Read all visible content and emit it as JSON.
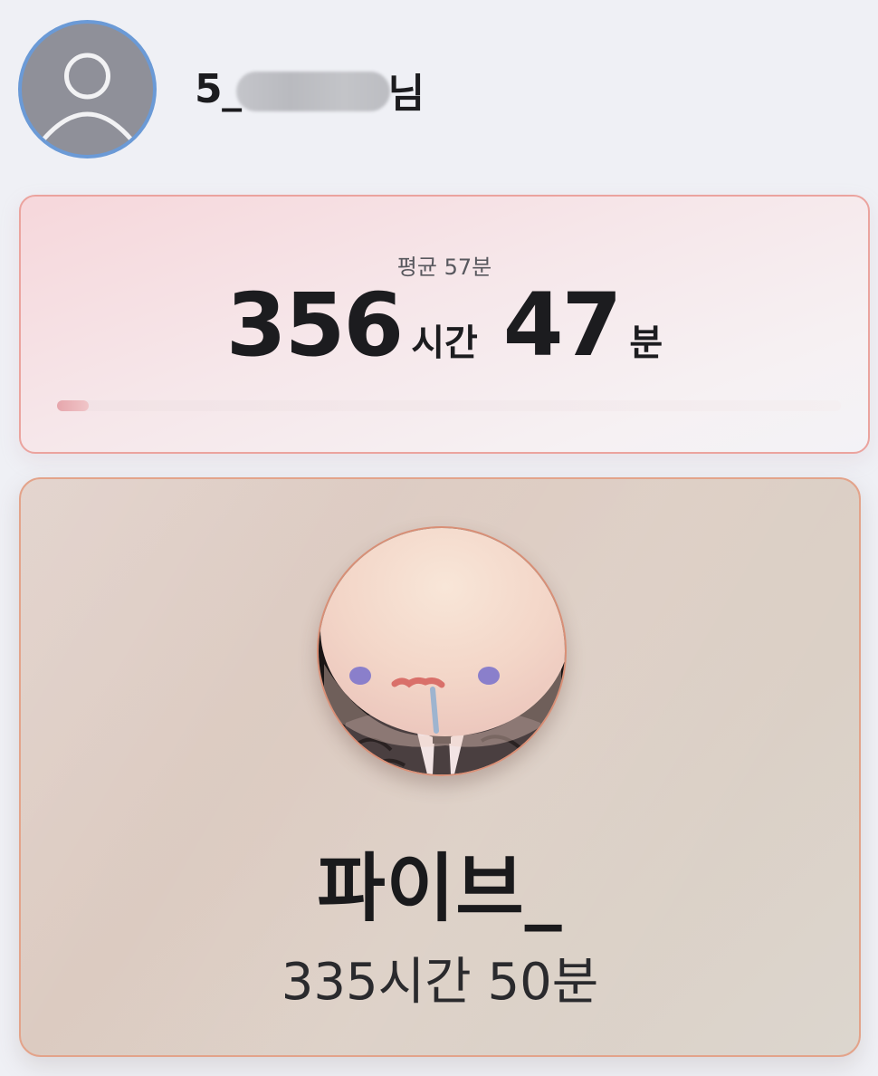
{
  "header": {
    "avatar_icon": "default-user-icon",
    "username_prefix": "5_",
    "username_suffix": "님"
  },
  "stats": {
    "average_label": "평균 57분",
    "total_hours": "356",
    "hours_unit": "시간",
    "total_minutes": "47",
    "minutes_unit": "분",
    "progress_fraction": 0.04
  },
  "top_user": {
    "name": "파이브_",
    "time": "335시간 50분",
    "avatar_icon": "character-avatar-icon"
  },
  "colors": {
    "accent_blue": "#6b9ad6",
    "stats_border": "#eba39e",
    "card_border": "#e3a38a",
    "background": "#eff0f5"
  }
}
